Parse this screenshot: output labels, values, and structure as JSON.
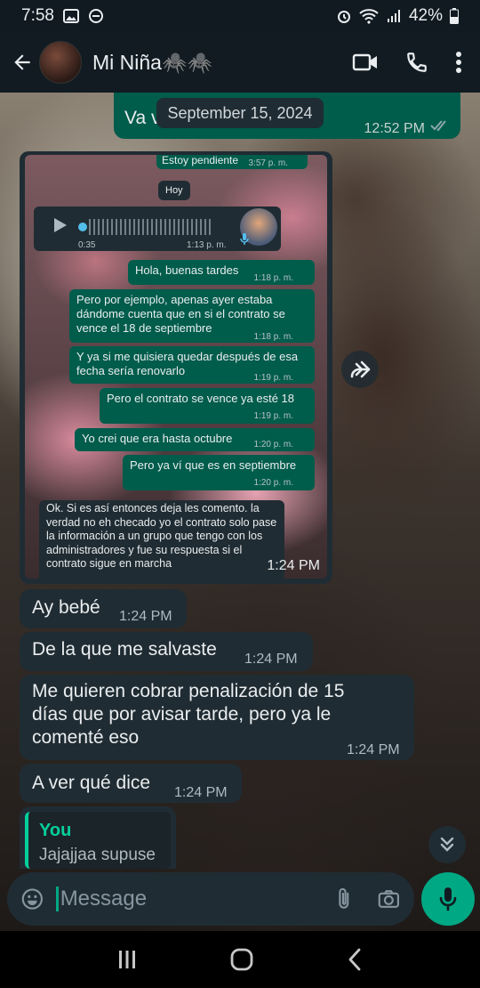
{
  "status": {
    "time": "7:58",
    "battery": "42%"
  },
  "header": {
    "contact_name": "Mi Niña🕷️🕷️"
  },
  "date_chip": "September 15, 2024",
  "top_out": {
    "text": "Va v",
    "time": "12:52 PM"
  },
  "screenshot": {
    "prev_text": "Estoy pendiente",
    "prev_time": "3:57 p. m.",
    "day_label": "Hoy",
    "voice_duration": "0:35",
    "voice_time": "1:13 p. m.",
    "messages": [
      {
        "text": "Hola, buenas tardes",
        "time": "1:18 p. m."
      },
      {
        "text": "Pero por ejemplo, apenas ayer estaba dándome cuenta que en si el contrato se vence el 18 de septiembre",
        "time": "1:18 p. m."
      },
      {
        "text": "Y ya si me quisiera quedar después de esa fecha sería renovarlo",
        "time": "1:19 p. m."
      },
      {
        "text": "Pero el contrato se vence ya esté 18",
        "time": "1:19 p. m."
      },
      {
        "text": "Yo crei que era hasta octubre",
        "time": "1:20 p. m."
      },
      {
        "text": "Pero ya ví que es en septiembre",
        "time": "1:20 p. m."
      }
    ],
    "reply_text": "Ok. Si es así entonces deja les comento. la verdad no eh checado yo el contrato solo pase la información a un grupo que tengo con los administradores y fue su respuesta si el contrato sigue en marcha",
    "bubble_time": "1:24 PM"
  },
  "messages": [
    {
      "text": "Ay bebé",
      "time": "1:24 PM"
    },
    {
      "text": "De la que me salvaste",
      "time": "1:24 PM"
    },
    {
      "text": "Me quieren cobrar penalización de 15 días que por avisar tarde, pero ya le comenté eso",
      "time": "1:24 PM"
    },
    {
      "text": "A ver qué dice",
      "time": "1:24 PM"
    }
  ],
  "quote": {
    "author": "You",
    "text": "Jajajjaa supuse"
  },
  "composer": {
    "placeholder": "Message"
  },
  "colors": {
    "accent": "#00a884",
    "incoming": "#202c33",
    "outgoing": "#005c4b"
  }
}
